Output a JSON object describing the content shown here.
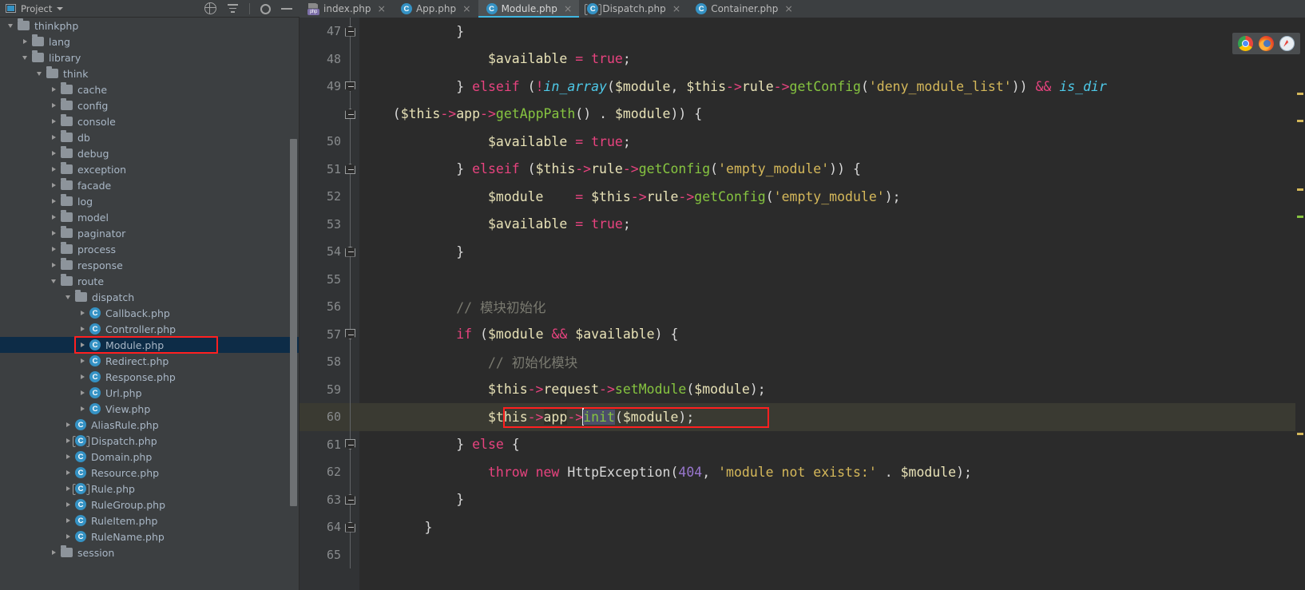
{
  "project_panel": {
    "title": "Project",
    "icons": [
      "project-window-icon",
      "chevron-down-icon",
      "locate-icon",
      "collapse-all-icon",
      "gear-icon",
      "minimize-icon"
    ]
  },
  "tree": [
    {
      "label": "thinkphp",
      "depth": 0,
      "type": "folder",
      "expanded": true
    },
    {
      "label": "lang",
      "depth": 1,
      "type": "folder",
      "expanded": false
    },
    {
      "label": "library",
      "depth": 1,
      "type": "folder",
      "expanded": true
    },
    {
      "label": "think",
      "depth": 2,
      "type": "folder",
      "expanded": true
    },
    {
      "label": "cache",
      "depth": 3,
      "type": "folder",
      "expanded": false
    },
    {
      "label": "config",
      "depth": 3,
      "type": "folder",
      "expanded": false
    },
    {
      "label": "console",
      "depth": 3,
      "type": "folder",
      "expanded": false
    },
    {
      "label": "db",
      "depth": 3,
      "type": "folder",
      "expanded": false
    },
    {
      "label": "debug",
      "depth": 3,
      "type": "folder",
      "expanded": false
    },
    {
      "label": "exception",
      "depth": 3,
      "type": "folder",
      "expanded": false
    },
    {
      "label": "facade",
      "depth": 3,
      "type": "folder",
      "expanded": false
    },
    {
      "label": "log",
      "depth": 3,
      "type": "folder",
      "expanded": false
    },
    {
      "label": "model",
      "depth": 3,
      "type": "folder",
      "expanded": false
    },
    {
      "label": "paginator",
      "depth": 3,
      "type": "folder",
      "expanded": false
    },
    {
      "label": "process",
      "depth": 3,
      "type": "folder",
      "expanded": false
    },
    {
      "label": "response",
      "depth": 3,
      "type": "folder",
      "expanded": false
    },
    {
      "label": "route",
      "depth": 3,
      "type": "folder",
      "expanded": true
    },
    {
      "label": "dispatch",
      "depth": 4,
      "type": "folder",
      "expanded": true
    },
    {
      "label": "Callback.php",
      "depth": 5,
      "type": "class"
    },
    {
      "label": "Controller.php",
      "depth": 5,
      "type": "class"
    },
    {
      "label": "Module.php",
      "depth": 5,
      "type": "class",
      "selected": true,
      "annotated": true
    },
    {
      "label": "Redirect.php",
      "depth": 5,
      "type": "class"
    },
    {
      "label": "Response.php",
      "depth": 5,
      "type": "class"
    },
    {
      "label": "Url.php",
      "depth": 5,
      "type": "class"
    },
    {
      "label": "View.php",
      "depth": 5,
      "type": "class"
    },
    {
      "label": "AliasRule.php",
      "depth": 4,
      "type": "class"
    },
    {
      "label": "Dispatch.php",
      "depth": 4,
      "type": "abstract"
    },
    {
      "label": "Domain.php",
      "depth": 4,
      "type": "class"
    },
    {
      "label": "Resource.php",
      "depth": 4,
      "type": "class"
    },
    {
      "label": "Rule.php",
      "depth": 4,
      "type": "abstract"
    },
    {
      "label": "RuleGroup.php",
      "depth": 4,
      "type": "class"
    },
    {
      "label": "RuleItem.php",
      "depth": 4,
      "type": "class"
    },
    {
      "label": "RuleName.php",
      "depth": 4,
      "type": "class"
    },
    {
      "label": "session",
      "depth": 3,
      "type": "folder",
      "expanded": false
    }
  ],
  "tabs": [
    {
      "label": "index.php",
      "icon": "php-file-icon",
      "active": false
    },
    {
      "label": "App.php",
      "icon": "php-class-icon",
      "active": false
    },
    {
      "label": "Module.php",
      "icon": "php-class-icon",
      "active": true
    },
    {
      "label": "Dispatch.php",
      "icon": "php-abstract-icon",
      "active": false
    },
    {
      "label": "Container.php",
      "icon": "php-class-icon",
      "active": false
    }
  ],
  "editor": {
    "first_line": 47,
    "caret_line": 60,
    "selected_token": "init",
    "lines": [
      {
        "n": 47,
        "fold": "bot"
      },
      {
        "n": 48
      },
      {
        "n": 49,
        "fold": "top"
      },
      {
        "n": 0,
        "fold": "bot_small"
      },
      {
        "n": 50
      },
      {
        "n": 51,
        "fold": "bot"
      },
      {
        "n": 52
      },
      {
        "n": 53
      },
      {
        "n": 54,
        "fold": "bot"
      },
      {
        "n": 55
      },
      {
        "n": 56
      },
      {
        "n": 57,
        "fold": "top"
      },
      {
        "n": 58
      },
      {
        "n": 59
      },
      {
        "n": 60,
        "caret": true,
        "annotated": true
      },
      {
        "n": 61,
        "fold": "top"
      },
      {
        "n": 62
      },
      {
        "n": 63,
        "fold": "bot"
      },
      {
        "n": 64,
        "fold": "bot"
      },
      {
        "n": 65
      }
    ],
    "comments": {
      "line56": "// 模块初始化",
      "line58": "// 初始化模块"
    },
    "strings": {
      "deny_module_list": "'deny_module_list'",
      "empty_module": "'empty_module'",
      "module_not_exists": "'module not exists:'"
    },
    "numbers": {
      "http_status": "404"
    }
  },
  "browser_popup": {
    "icons": [
      "chrome-icon",
      "firefox-icon",
      "safari-icon"
    ]
  },
  "colors": {
    "accent": "#40b6e0",
    "selection": "#0d2c47",
    "annotation": "#ff2020",
    "editor_bg": "#2b2b2b",
    "panel_bg": "#3c3f41",
    "caret_line_bg": "#3a3a32"
  }
}
